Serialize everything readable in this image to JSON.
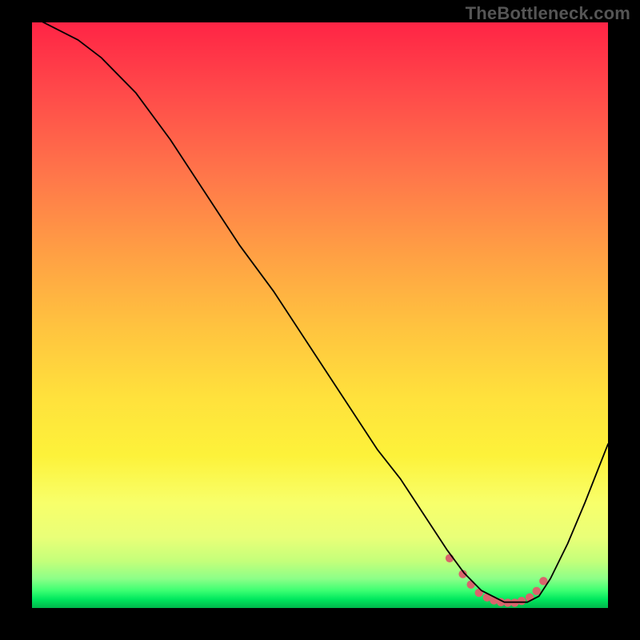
{
  "watermark": "TheBottleneck.com",
  "colors": {
    "background": "#000000",
    "marker": "#d9646c",
    "curve": "#000000",
    "gradient_top": "#ff2445",
    "gradient_bottom": "#00b84c"
  },
  "chart_data": {
    "type": "line",
    "title": "",
    "xlabel": "",
    "ylabel": "",
    "xlim": [
      0,
      100
    ],
    "ylim": [
      0,
      100
    ],
    "series": [
      {
        "name": "curve",
        "x": [
          0,
          4,
          8,
          12,
          18,
          24,
          30,
          36,
          42,
          48,
          54,
          60,
          64,
          68,
          72,
          75,
          78,
          82,
          86,
          88,
          90,
          93,
          96,
          100
        ],
        "y": [
          101,
          99,
          97,
          94,
          88,
          80,
          71,
          62,
          54,
          45,
          36,
          27,
          22,
          16,
          10,
          6,
          3,
          1,
          1,
          2,
          5,
          11,
          18,
          28
        ]
      }
    ],
    "markers": {
      "name": "bottom-cluster",
      "x": [
        72.5,
        74.8,
        76.2,
        77.6,
        79.0,
        80.2,
        81.4,
        82.6,
        83.8,
        85.0,
        86.4,
        87.6,
        88.8
      ],
      "y": [
        8.5,
        5.8,
        4.0,
        2.6,
        1.8,
        1.3,
        1.0,
        0.9,
        0.9,
        1.2,
        1.8,
        2.9,
        4.6
      ]
    }
  }
}
